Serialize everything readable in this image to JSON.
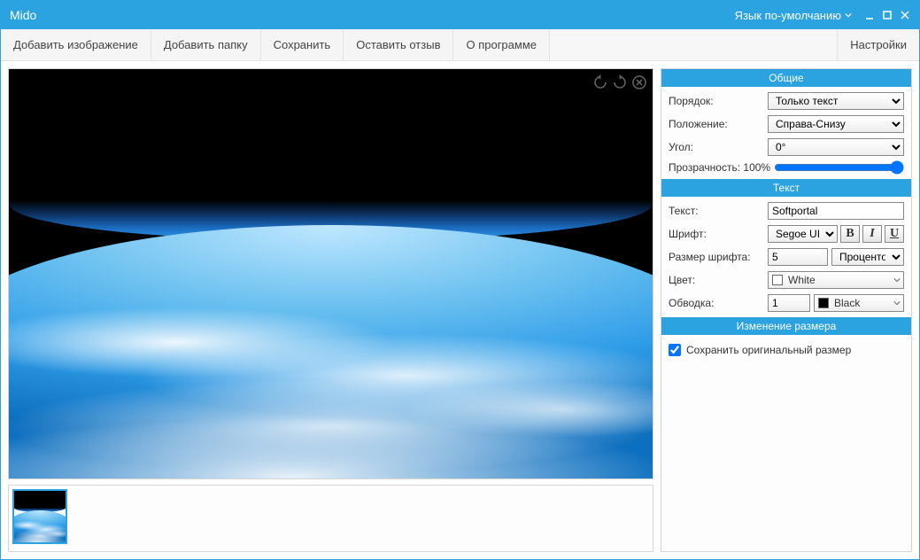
{
  "titlebar": {
    "title": "Mido",
    "language": "Язык по-умолчанию"
  },
  "toolbar": {
    "add_image": "Добавить изображение",
    "add_folder": "Добавить папку",
    "save": "Сохранить",
    "feedback": "Оставить отзыв",
    "about": "О программе",
    "settings": "Настройки"
  },
  "panel": {
    "general": {
      "header": "Общие",
      "order_label": "Порядок:",
      "order_value": "Только текст",
      "position_label": "Положение:",
      "position_value": "Справа-Снизу",
      "angle_label": "Угол:",
      "angle_value": "0°",
      "opacity_label": "Прозрачность:",
      "opacity_value": "100%"
    },
    "text": {
      "header": "Текст",
      "text_label": "Текст:",
      "text_value": "Softportal",
      "font_label": "Шрифт:",
      "font_value": "Segoe UI",
      "bold": "B",
      "italic": "I",
      "under": "U",
      "size_label": "Размер шрифта:",
      "size_value": "5",
      "size_unit": "Процентов",
      "color_label": "Цвет:",
      "color_value": "White",
      "color_hex": "#ffffff",
      "stroke_label": "Обводка:",
      "stroke_value": "1",
      "stroke_color": "Black",
      "stroke_hex": "#000000"
    },
    "resize": {
      "header": "Изменение размера",
      "keep_original": "Сохранить оригинальный размер",
      "keep_original_checked": true
    }
  }
}
